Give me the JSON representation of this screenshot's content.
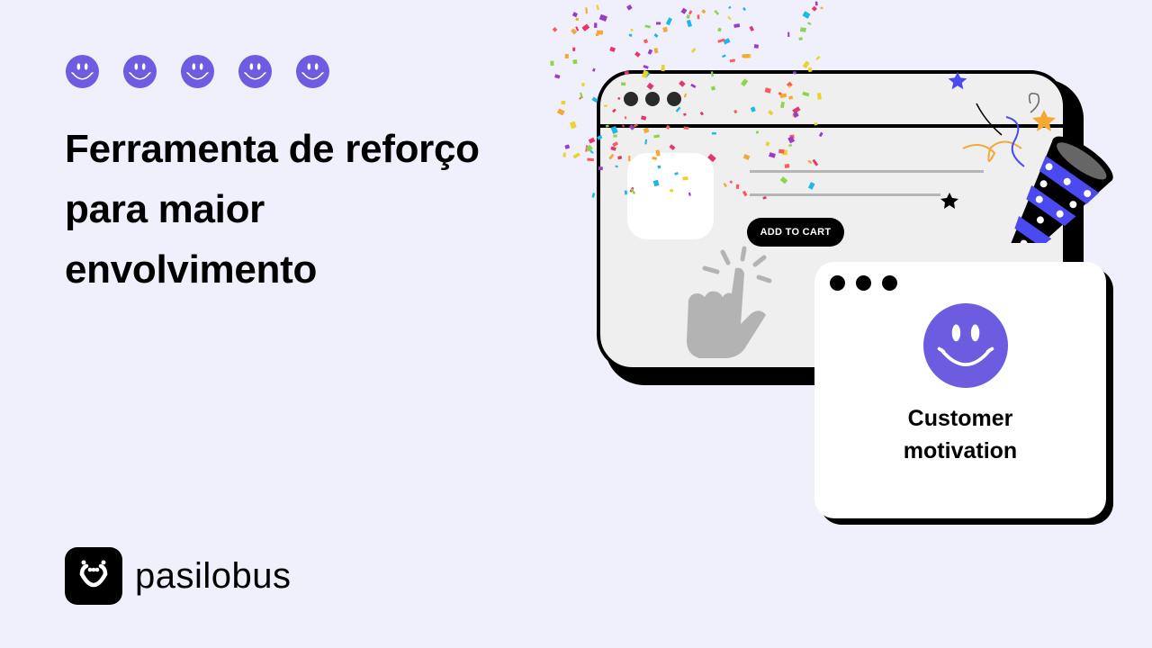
{
  "rating": {
    "count": 5,
    "icon": "smiley-face-icon",
    "color": "#6b5ce0"
  },
  "headline": {
    "lines": [
      "Ferramenta de reforço",
      "para maior",
      "envolvimento"
    ]
  },
  "brand": {
    "name": "pasilobus",
    "logo_icon": "pasilobus-logo-icon"
  },
  "illustration": {
    "product_window": {
      "button_label": "ADD TO CART",
      "cursor_icon": "pointing-hand-icon",
      "popper_icon": "party-popper-icon"
    },
    "motivation_window": {
      "icon": "smiley-face-icon",
      "caption_lines": [
        "Customer",
        "motivation"
      ]
    }
  },
  "colors": {
    "background": "#f0f0fc",
    "accent": "#6b5ce0",
    "popper_blue": "#4a4af0",
    "text": "#000000"
  }
}
